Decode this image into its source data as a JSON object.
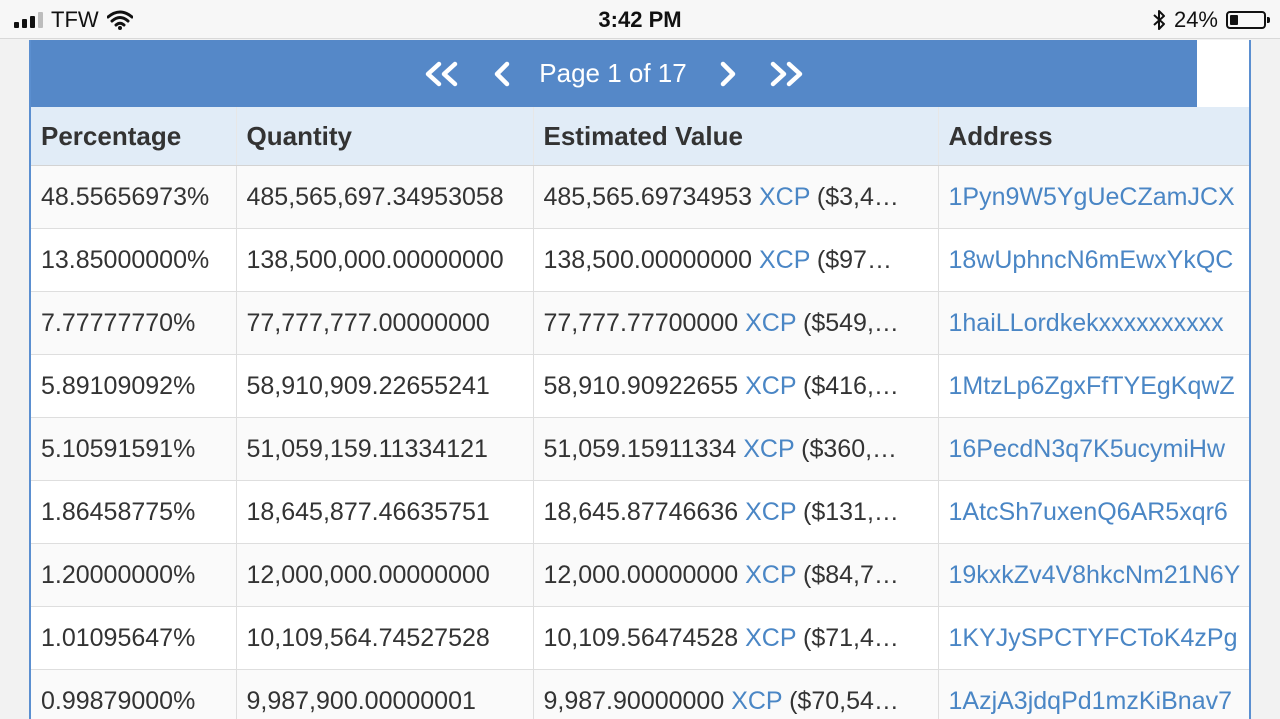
{
  "status_bar": {
    "carrier": "TFW",
    "time": "3:42 PM",
    "battery": "24%",
    "battery_level": 0.24
  },
  "pager": {
    "label": "Page 1 of 17",
    "first_icon": "double-chevron-left",
    "prev_icon": "chevron-left",
    "next_icon": "chevron-right",
    "last_icon": "double-chevron-right"
  },
  "table": {
    "headers": [
      "Percentage",
      "Quantity",
      "Estimated Value",
      "Address"
    ],
    "rows": [
      {
        "percentage": "48.55656973%",
        "quantity": "485,565,697.34953058",
        "value": "485,565.69734953",
        "asset": "XCP",
        "usd": "($3,4…",
        "address": "1Pyn9W5YgUeCZamJCX"
      },
      {
        "percentage": "13.85000000%",
        "quantity": "138,500,000.00000000",
        "value": "138,500.00000000",
        "asset": "XCP",
        "usd": "($97…",
        "address": "18wUphncN6mEwxYkQC"
      },
      {
        "percentage": "7.77777770%",
        "quantity": "77,777,777.00000000",
        "value": "77,777.77700000",
        "asset": "XCP",
        "usd": "($549,…",
        "address": "1haiLLordkekxxxxxxxxxx"
      },
      {
        "percentage": "5.89109092%",
        "quantity": "58,910,909.22655241",
        "value": "58,910.90922655",
        "asset": "XCP",
        "usd": "($416,…",
        "address": "1MtzLp6ZgxFfTYEgKqwZ"
      },
      {
        "percentage": "5.10591591%",
        "quantity": "51,059,159.11334121",
        "value": "51,059.15911334",
        "asset": "XCP",
        "usd": "($360,…",
        "address": "16PecdN3q7K5ucymiHw"
      },
      {
        "percentage": "1.86458775%",
        "quantity": "18,645,877.46635751",
        "value": "18,645.87746636",
        "asset": "XCP",
        "usd": "($131,…",
        "address": "1AtcSh7uxenQ6AR5xqr6"
      },
      {
        "percentage": "1.20000000%",
        "quantity": "12,000,000.00000000",
        "value": "12,000.00000000",
        "asset": "XCP",
        "usd": "($84,7…",
        "address": "19kxkZv4V8hkcNm21N6Y"
      },
      {
        "percentage": "1.01095647%",
        "quantity": "10,109,564.74527528",
        "value": "10,109.56474528",
        "asset": "XCP",
        "usd": "($71,4…",
        "address": "1KYJySPCTYFCToK4zPg"
      },
      {
        "percentage": "0.99879000%",
        "quantity": "9,987,900.00000001",
        "value": "9,987.90000000",
        "asset": "XCP",
        "usd": "($70,54…",
        "address": "1AzjA3jdqPd1mzKiBnav7"
      }
    ]
  }
}
